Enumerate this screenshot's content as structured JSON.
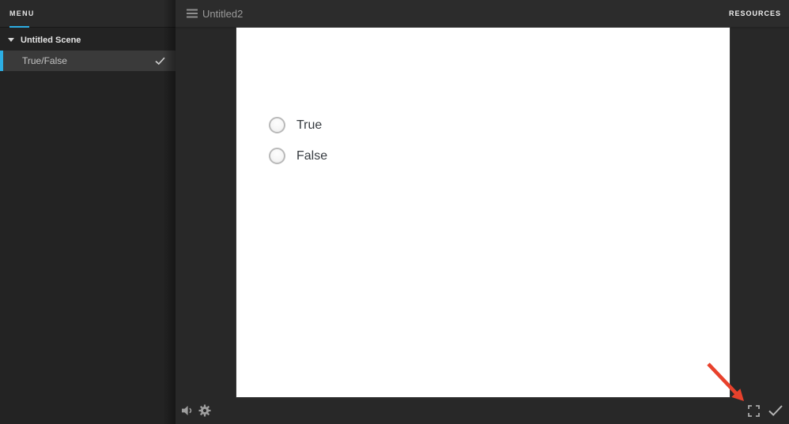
{
  "topbar": {
    "title": "Untitled2",
    "resources_label": "RESOURCES"
  },
  "sidebar": {
    "menu_label": "MENU",
    "scene_label": "Untitled Scene",
    "slide_label": "True/False",
    "slide_selected": true,
    "slide_completed_check": true
  },
  "stage": {
    "options": [
      {
        "label": "True",
        "selected": false
      },
      {
        "label": "False",
        "selected": false
      }
    ]
  },
  "player_controls": {
    "left_icons": [
      "volume-icon",
      "gear-icon"
    ],
    "right_icons": [
      "fullscreen-icon",
      "submit-check-icon"
    ]
  },
  "annotation": {
    "arrow_target": "fullscreen-icon"
  },
  "icons": {
    "hamburger": "hamburger-menu-icon",
    "scene_caret": "chevron-down-icon",
    "slide_check": "check-icon",
    "volume": "volume-icon",
    "gear": "gear-icon",
    "fullscreen": "fullscreen-icon",
    "submit": "submit-check-icon"
  },
  "colors": {
    "accent": "#2caee4",
    "arrow": "#e8412c",
    "stage_background": "#ffffff",
    "sidebar_background": "#232323",
    "main_background": "#282828",
    "selected_row_background": "#3a3a3a"
  }
}
